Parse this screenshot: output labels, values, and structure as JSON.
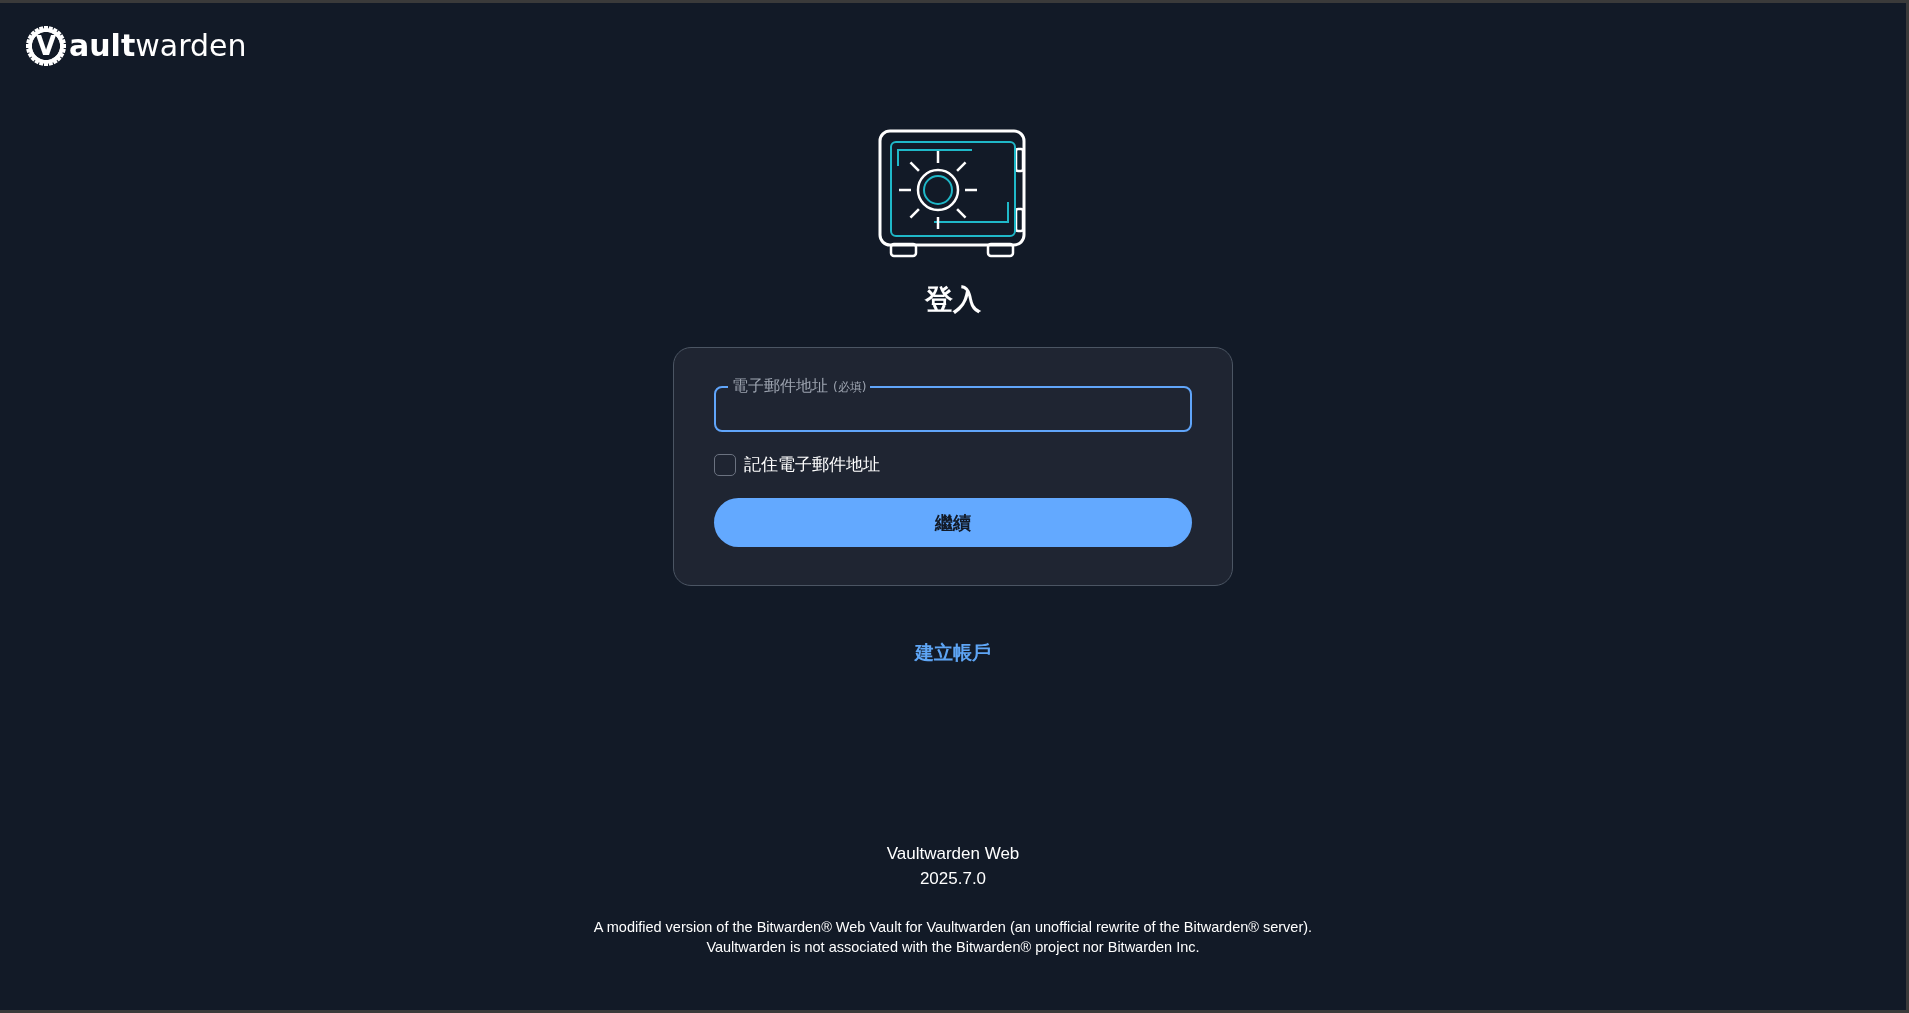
{
  "logo": {
    "initial": "V",
    "bold": "ault",
    "rest": "warden"
  },
  "title": "登入",
  "email_field": {
    "label": "電子郵件地址",
    "required": "(必填)",
    "focused": true
  },
  "remember": {
    "label": "記住電子郵件地址",
    "checked": false
  },
  "continue_button": "繼續",
  "create_account_link": "建立帳戶",
  "footer": {
    "app_name": "Vaultwarden Web",
    "version": "2025.7.0",
    "disclaimer": [
      "A modified version of the Bitwarden® Web Vault for Vaultwarden (an unofficial rewrite of the Bitwarden® server).",
      "Vaultwarden is not associated with the Bitwarden® project nor Bitwarden Inc."
    ]
  }
}
